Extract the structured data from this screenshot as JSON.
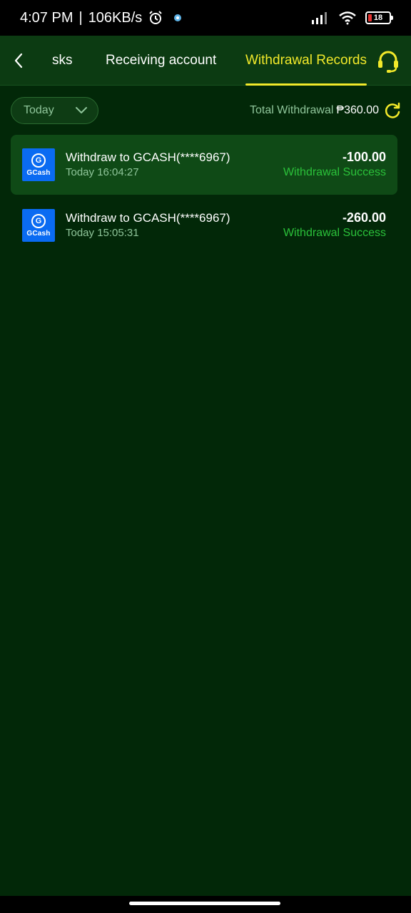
{
  "status_bar": {
    "time": "4:07 PM",
    "separator": "|",
    "speed": "106KB/s",
    "battery": "18",
    "battery_color": "#e5322f",
    "icons": [
      "alarm-icon",
      "app-notification-icon",
      "signal-icon",
      "wifi-icon",
      "battery-icon"
    ]
  },
  "header": {
    "back_icon": "chevron-left-icon",
    "tabs": [
      {
        "label": "sks",
        "active": false
      },
      {
        "label": "Receiving account",
        "active": false
      },
      {
        "label": "Withdrawal Records",
        "active": true
      }
    ],
    "support_icon": "headset-icon"
  },
  "filter": {
    "selected": "Today",
    "total_label": "Total Withdrawal",
    "total_value": "₱360.00",
    "refresh_icon": "refresh-icon"
  },
  "records": [
    {
      "logo_text": "GCash",
      "logo_letter": "G",
      "title": "Withdraw to GCASH(****6967)",
      "time": "Today 16:04:27",
      "amount": "-100.00",
      "status": "Withdrawal Success"
    },
    {
      "logo_text": "GCash",
      "logo_letter": "G",
      "title": "Withdraw to GCASH(****6967)",
      "time": "Today 15:05:31",
      "amount": "-260.00",
      "status": "Withdrawal Success"
    }
  ],
  "colors": {
    "background": "#022808",
    "header": "#0c3b12",
    "accent": "#f2e92a",
    "success": "#2bc13a",
    "gcash_blue": "#0a6bf2"
  }
}
